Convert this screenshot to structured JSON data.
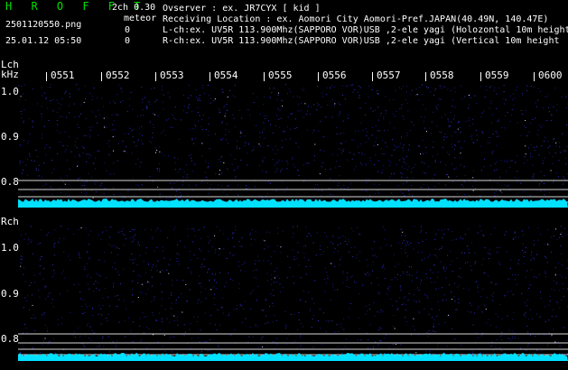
{
  "header": {
    "app_name": "H R O F F T",
    "version": "2ch 0.30",
    "filename": "2501120550.png",
    "meteor_label": "meteor",
    "meteor_count_l": "0",
    "meteor_count_r": "0",
    "datetime": "25.01.12 05:50",
    "observer": "Ovserver            : ex. JR7CYX [ kid ]",
    "location": "Receiving Location : ex. Aomori City Aomori-Pref.JAPAN(40.49N, 140.47E)",
    "lch_info": "L-ch:ex. UV5R 113.900Mhz(SAPPORO VOR)USB ,2-ele yagi (Holozontal 10m height",
    "rch_info": "R-ch:ex. UV5R 113.900Mhz(SAPPORO VOR)USB ,2-ele yagi (Vertical 10m height"
  },
  "left_channel": {
    "label": "Lch",
    "unit": "kHz",
    "y_ticks": [
      "1.0",
      "0.9",
      "0.8"
    ]
  },
  "right_channel": {
    "label": "Rch",
    "y_ticks": [
      "1.0",
      "0.9",
      "0.8"
    ]
  },
  "time_axis": [
    "0551",
    "0552",
    "0553",
    "0554",
    "0555",
    "0556",
    "0557",
    "0558",
    "0559",
    "0600"
  ],
  "colors": {
    "background": "#000000",
    "noise": "#2020c0",
    "trace": "#00e0ff",
    "title_green": "#00e000"
  }
}
